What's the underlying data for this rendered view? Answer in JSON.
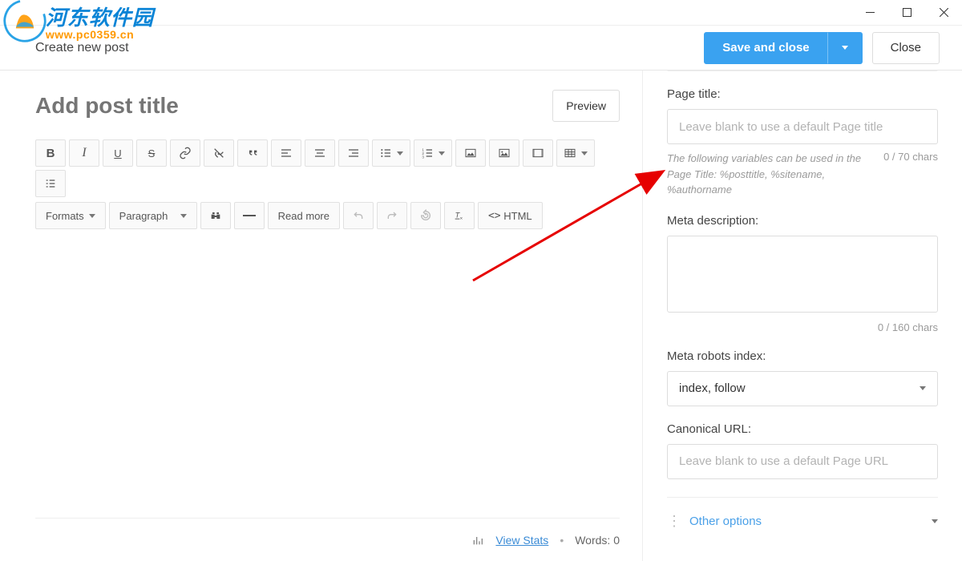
{
  "watermark": {
    "cn": "河东软件园",
    "url": "www.pc0359.cn"
  },
  "header": {
    "title": "Create new post",
    "save_label": "Save and close",
    "close_label": "Close"
  },
  "editor": {
    "title_placeholder": "Add post title",
    "preview_label": "Preview",
    "toolbar": {
      "formats": "Formats",
      "paragraph": "Paragraph",
      "readmore": "Read more",
      "html": "HTML"
    },
    "footer": {
      "stats_link": "View Stats",
      "words_label": "Words:",
      "words_count": "0"
    }
  },
  "sidebar": {
    "page_title": {
      "label": "Page title:",
      "placeholder": "Leave blank to use a default Page title",
      "hint": "The following variables can be used in the Page Title: %posttitle, %sitename, %authorname",
      "count": "0 / 70 chars"
    },
    "meta_desc": {
      "label": "Meta description:",
      "count": "0 / 160 chars"
    },
    "meta_robots": {
      "label": "Meta robots index:",
      "value": "index, follow"
    },
    "canonical": {
      "label": "Canonical URL:",
      "placeholder": "Leave blank to use a default Page URL"
    },
    "other": "Other options"
  }
}
